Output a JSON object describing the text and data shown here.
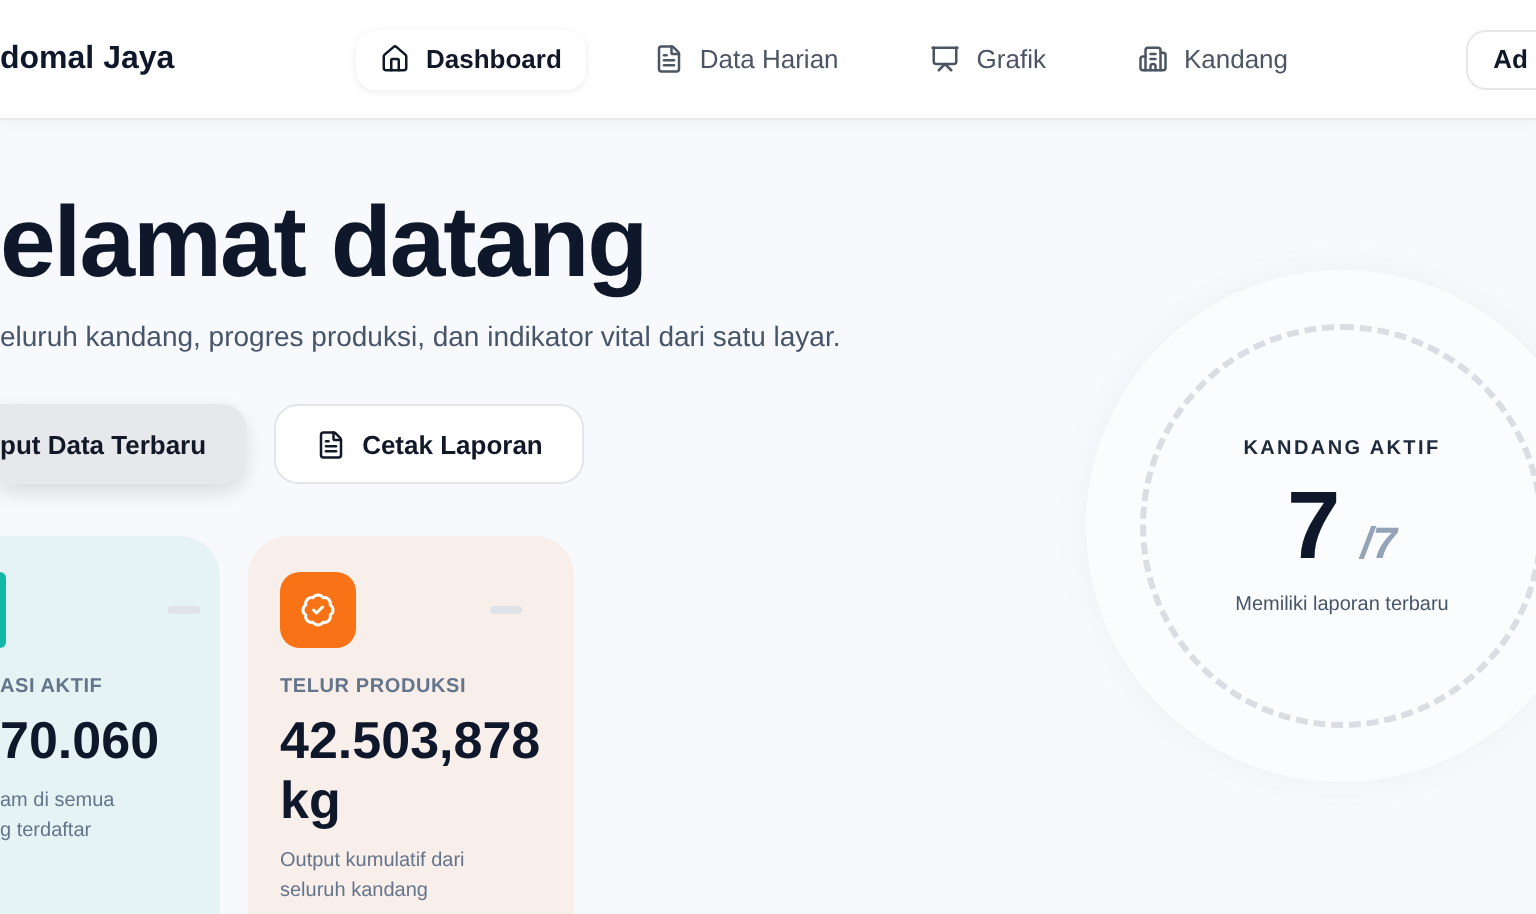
{
  "header": {
    "brand": "domal Jaya",
    "nav": [
      {
        "label": "Dashboard",
        "selected": true
      },
      {
        "label": "Data Harian",
        "selected": false
      },
      {
        "label": "Grafik",
        "selected": false
      },
      {
        "label": "Kandang",
        "selected": false
      }
    ],
    "user_button": "Ad"
  },
  "hero": {
    "title": "elamat datang",
    "subtitle": "eluruh kandang, progres produksi, dan indikator vital dari satu layar.",
    "buttons": [
      {
        "label": "put Data Terbaru",
        "kind": "primary"
      },
      {
        "label": "Cetak Laporan",
        "kind": "secondary"
      }
    ]
  },
  "stats": [
    {
      "label": "ASI AKTIF",
      "value": "70.060",
      "description": "am di semua\ng terdaftar",
      "color": "#14b8a6",
      "cut": true
    },
    {
      "label": "TELUR PRODUKSI",
      "value": "42.503,878 kg",
      "description": "Output kumulatif dari\nseluruh kandang",
      "color": "#f97316",
      "cut": false
    }
  ],
  "active_cages": {
    "label": "KANDANG AKTIF",
    "value": "7",
    "total": "/7",
    "caption": "Memiliki laporan terbaru"
  }
}
